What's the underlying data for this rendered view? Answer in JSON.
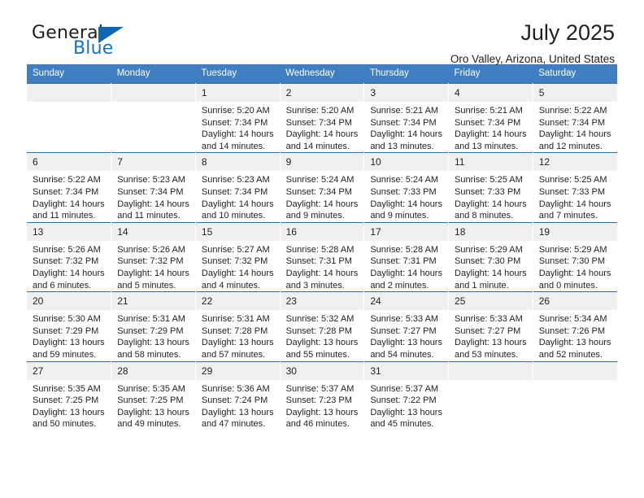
{
  "brand": {
    "word_one": "General",
    "word_two": "Blue"
  },
  "header": {
    "title": "July 2025",
    "location": "Oro Valley, Arizona, United States"
  },
  "colors": {
    "header_blue": "#3f7fc1",
    "row_border_blue": "#2e6da4",
    "daynum_gray": "#f0f0f0",
    "brand_blue": "#1473bd",
    "text": "#231f20"
  },
  "weekday_headers": [
    "Sunday",
    "Monday",
    "Tuesday",
    "Wednesday",
    "Thursday",
    "Friday",
    "Saturday"
  ],
  "weeks": [
    [
      {
        "day": "",
        "sunrise": "",
        "sunset": "",
        "daylight": ""
      },
      {
        "day": "",
        "sunrise": "",
        "sunset": "",
        "daylight": ""
      },
      {
        "day": "1",
        "sunrise": "Sunrise: 5:20 AM",
        "sunset": "Sunset: 7:34 PM",
        "daylight": "Daylight: 14 hours and 14 minutes."
      },
      {
        "day": "2",
        "sunrise": "Sunrise: 5:20 AM",
        "sunset": "Sunset: 7:34 PM",
        "daylight": "Daylight: 14 hours and 14 minutes."
      },
      {
        "day": "3",
        "sunrise": "Sunrise: 5:21 AM",
        "sunset": "Sunset: 7:34 PM",
        "daylight": "Daylight: 14 hours and 13 minutes."
      },
      {
        "day": "4",
        "sunrise": "Sunrise: 5:21 AM",
        "sunset": "Sunset: 7:34 PM",
        "daylight": "Daylight: 14 hours and 13 minutes."
      },
      {
        "day": "5",
        "sunrise": "Sunrise: 5:22 AM",
        "sunset": "Sunset: 7:34 PM",
        "daylight": "Daylight: 14 hours and 12 minutes."
      }
    ],
    [
      {
        "day": "6",
        "sunrise": "Sunrise: 5:22 AM",
        "sunset": "Sunset: 7:34 PM",
        "daylight": "Daylight: 14 hours and 11 minutes."
      },
      {
        "day": "7",
        "sunrise": "Sunrise: 5:23 AM",
        "sunset": "Sunset: 7:34 PM",
        "daylight": "Daylight: 14 hours and 11 minutes."
      },
      {
        "day": "8",
        "sunrise": "Sunrise: 5:23 AM",
        "sunset": "Sunset: 7:34 PM",
        "daylight": "Daylight: 14 hours and 10 minutes."
      },
      {
        "day": "9",
        "sunrise": "Sunrise: 5:24 AM",
        "sunset": "Sunset: 7:34 PM",
        "daylight": "Daylight: 14 hours and 9 minutes."
      },
      {
        "day": "10",
        "sunrise": "Sunrise: 5:24 AM",
        "sunset": "Sunset: 7:33 PM",
        "daylight": "Daylight: 14 hours and 9 minutes."
      },
      {
        "day": "11",
        "sunrise": "Sunrise: 5:25 AM",
        "sunset": "Sunset: 7:33 PM",
        "daylight": "Daylight: 14 hours and 8 minutes."
      },
      {
        "day": "12",
        "sunrise": "Sunrise: 5:25 AM",
        "sunset": "Sunset: 7:33 PM",
        "daylight": "Daylight: 14 hours and 7 minutes."
      }
    ],
    [
      {
        "day": "13",
        "sunrise": "Sunrise: 5:26 AM",
        "sunset": "Sunset: 7:32 PM",
        "daylight": "Daylight: 14 hours and 6 minutes."
      },
      {
        "day": "14",
        "sunrise": "Sunrise: 5:26 AM",
        "sunset": "Sunset: 7:32 PM",
        "daylight": "Daylight: 14 hours and 5 minutes."
      },
      {
        "day": "15",
        "sunrise": "Sunrise: 5:27 AM",
        "sunset": "Sunset: 7:32 PM",
        "daylight": "Daylight: 14 hours and 4 minutes."
      },
      {
        "day": "16",
        "sunrise": "Sunrise: 5:28 AM",
        "sunset": "Sunset: 7:31 PM",
        "daylight": "Daylight: 14 hours and 3 minutes."
      },
      {
        "day": "17",
        "sunrise": "Sunrise: 5:28 AM",
        "sunset": "Sunset: 7:31 PM",
        "daylight": "Daylight: 14 hours and 2 minutes."
      },
      {
        "day": "18",
        "sunrise": "Sunrise: 5:29 AM",
        "sunset": "Sunset: 7:30 PM",
        "daylight": "Daylight: 14 hours and 1 minute."
      },
      {
        "day": "19",
        "sunrise": "Sunrise: 5:29 AM",
        "sunset": "Sunset: 7:30 PM",
        "daylight": "Daylight: 14 hours and 0 minutes."
      }
    ],
    [
      {
        "day": "20",
        "sunrise": "Sunrise: 5:30 AM",
        "sunset": "Sunset: 7:29 PM",
        "daylight": "Daylight: 13 hours and 59 minutes."
      },
      {
        "day": "21",
        "sunrise": "Sunrise: 5:31 AM",
        "sunset": "Sunset: 7:29 PM",
        "daylight": "Daylight: 13 hours and 58 minutes."
      },
      {
        "day": "22",
        "sunrise": "Sunrise: 5:31 AM",
        "sunset": "Sunset: 7:28 PM",
        "daylight": "Daylight: 13 hours and 57 minutes."
      },
      {
        "day": "23",
        "sunrise": "Sunrise: 5:32 AM",
        "sunset": "Sunset: 7:28 PM",
        "daylight": "Daylight: 13 hours and 55 minutes."
      },
      {
        "day": "24",
        "sunrise": "Sunrise: 5:33 AM",
        "sunset": "Sunset: 7:27 PM",
        "daylight": "Daylight: 13 hours and 54 minutes."
      },
      {
        "day": "25",
        "sunrise": "Sunrise: 5:33 AM",
        "sunset": "Sunset: 7:27 PM",
        "daylight": "Daylight: 13 hours and 53 minutes."
      },
      {
        "day": "26",
        "sunrise": "Sunrise: 5:34 AM",
        "sunset": "Sunset: 7:26 PM",
        "daylight": "Daylight: 13 hours and 52 minutes."
      }
    ],
    [
      {
        "day": "27",
        "sunrise": "Sunrise: 5:35 AM",
        "sunset": "Sunset: 7:25 PM",
        "daylight": "Daylight: 13 hours and 50 minutes."
      },
      {
        "day": "28",
        "sunrise": "Sunrise: 5:35 AM",
        "sunset": "Sunset: 7:25 PM",
        "daylight": "Daylight: 13 hours and 49 minutes."
      },
      {
        "day": "29",
        "sunrise": "Sunrise: 5:36 AM",
        "sunset": "Sunset: 7:24 PM",
        "daylight": "Daylight: 13 hours and 47 minutes."
      },
      {
        "day": "30",
        "sunrise": "Sunrise: 5:37 AM",
        "sunset": "Sunset: 7:23 PM",
        "daylight": "Daylight: 13 hours and 46 minutes."
      },
      {
        "day": "31",
        "sunrise": "Sunrise: 5:37 AM",
        "sunset": "Sunset: 7:22 PM",
        "daylight": "Daylight: 13 hours and 45 minutes."
      },
      {
        "day": "",
        "sunrise": "",
        "sunset": "",
        "daylight": ""
      },
      {
        "day": "",
        "sunrise": "",
        "sunset": "",
        "daylight": ""
      }
    ]
  ]
}
